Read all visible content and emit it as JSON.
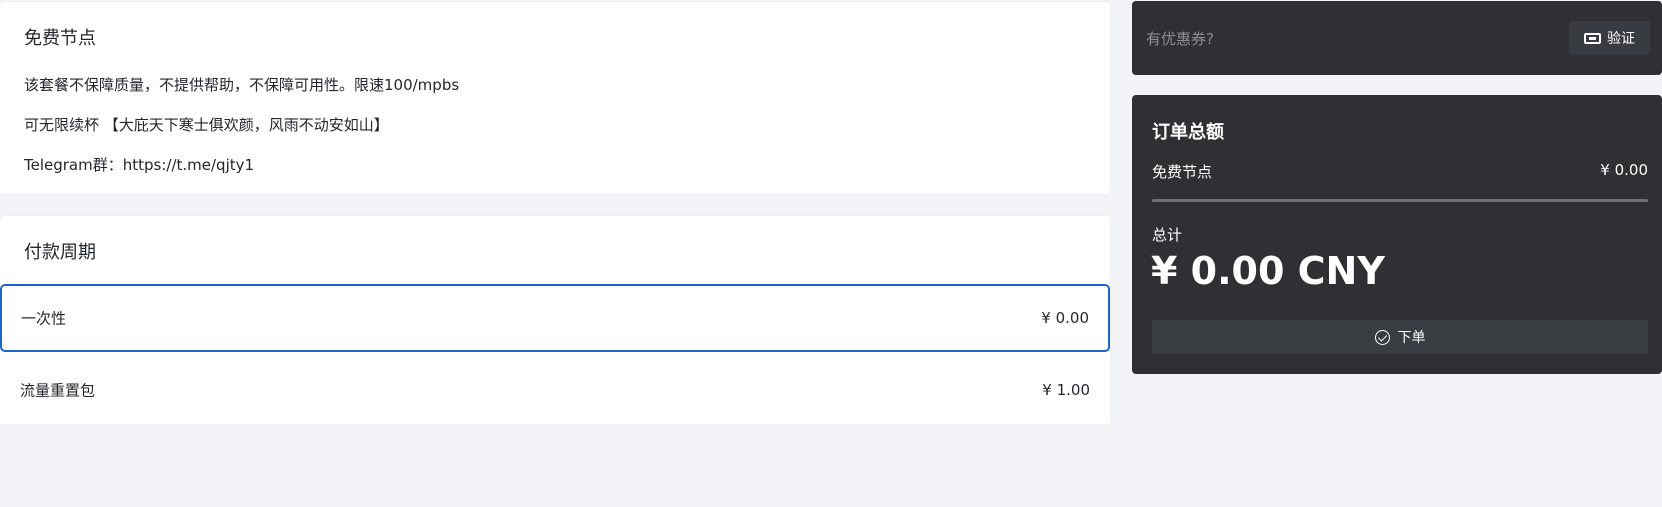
{
  "plan": {
    "title": "免费节点",
    "description": [
      "该套餐不保障质量，不提供帮助，不保障可用性。限速100/mpbs",
      "可无限续杯 【大庇天下寒士俱欢颜，风雨不动安如山】",
      "Telegram群：https://t.me/qjty1"
    ]
  },
  "payment_period": {
    "title": "付款周期",
    "options": [
      {
        "label": "一次性",
        "price": "¥ 0.00",
        "selected": true
      },
      {
        "label": "流量重置包",
        "price": "¥ 1.00",
        "selected": false
      }
    ]
  },
  "coupon": {
    "placeholder": "有优惠券?",
    "verify_label": "验证",
    "verify_icon": "ticket-icon"
  },
  "summary": {
    "title": "订单总额",
    "item_name": "免费节点",
    "item_price": "¥ 0.00",
    "total_label": "总计",
    "total_amount": "¥ 0.00 CNY",
    "order_label": "下单",
    "order_icon": "check-circle-icon"
  },
  "colors": {
    "background": "#f2f4f8",
    "card": "#ffffff",
    "dark_panel": "#2e3034",
    "selected_border": "#1a66c9"
  }
}
